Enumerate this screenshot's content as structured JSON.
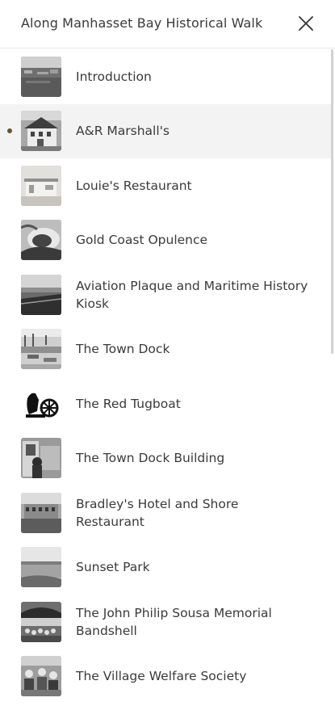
{
  "header": {
    "title": "Along Manhasset Bay Historical Walk",
    "close_icon": "close-icon"
  },
  "accent_color": "#6b5230",
  "items": [
    {
      "label": "Introduction",
      "active": false
    },
    {
      "label": "A&R Marshall's",
      "active": true
    },
    {
      "label": "Louie's Restaurant",
      "active": false
    },
    {
      "label": "Gold Coast Opulence",
      "active": false
    },
    {
      "label": "Aviation Plaque and Maritime History Kiosk",
      "active": false
    },
    {
      "label": "The Town Dock",
      "active": false
    },
    {
      "label": "The Red Tugboat",
      "active": false
    },
    {
      "label": "The Town Dock Building",
      "active": false
    },
    {
      "label": "Bradley's Hotel and Shore Restaurant",
      "active": false
    },
    {
      "label": "Sunset Park",
      "active": false
    },
    {
      "label": "The John Philip Sousa Memorial Bandshell",
      "active": false
    },
    {
      "label": "The Village Welfare Society",
      "active": false
    }
  ]
}
